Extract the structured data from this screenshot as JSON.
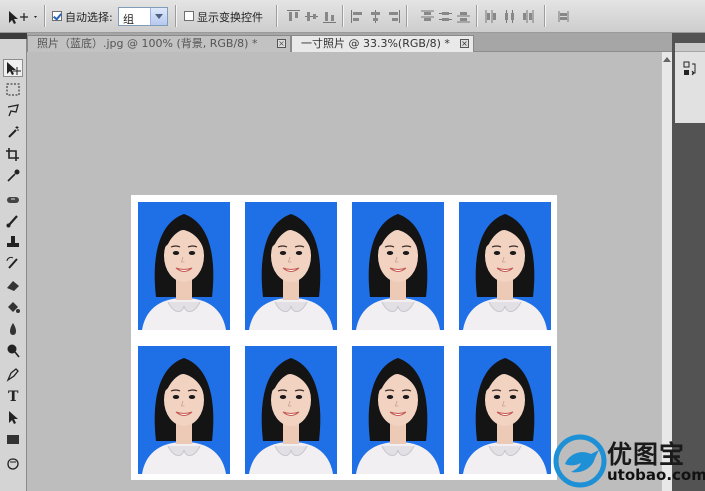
{
  "options_bar": {
    "auto_select_label": "自动选择:",
    "auto_select_checked": true,
    "auto_select_value": "组",
    "show_transform_label": "显示变换控件",
    "show_transform_checked": false
  },
  "tabs": [
    {
      "label": "照片（蓝底）.jpg @ 100% (背景, RGB/8) *",
      "active": false
    },
    {
      "label": "一寸照片 @ 33.3%(RGB/8) *",
      "active": true
    }
  ],
  "tab_close_glyph": "×",
  "tools": [
    "move-icon",
    "marquee-icon",
    "lasso-icon",
    "magic-wand-icon",
    "crop-icon",
    "eyedropper-icon",
    "healing-brush-icon",
    "brush-icon",
    "clone-stamp-icon",
    "history-brush-icon",
    "eraser-icon",
    "paint-bucket-icon",
    "blur-icon",
    "dodge-icon",
    "pen-icon",
    "type-icon",
    "path-select-icon",
    "rectangle-icon",
    "hand-icon"
  ],
  "type_tool_glyph": "T",
  "document": {
    "photo_rows": 2,
    "photo_cols": 4,
    "photo_background": "#1f6fe6",
    "paper_color": "#ffffff"
  },
  "watermark": {
    "title": "优图宝",
    "url": "utobao.com"
  },
  "colors": {
    "workspace": "#bdbdbd",
    "panel_dark": "#535353",
    "photo_blue": "#1f6fe6",
    "logo_blue": "#1e90d6"
  }
}
